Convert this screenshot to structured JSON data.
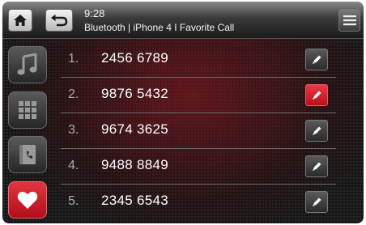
{
  "header": {
    "time": "9:28",
    "breadcrumb": "Bluetooth | iPhone 4 I Favorite Call"
  },
  "toolbar": {
    "home_icon": "home-icon",
    "back_icon": "back-arrow-icon",
    "menu_icon": "hamburger-menu-icon"
  },
  "sidebar": {
    "items": [
      {
        "icon": "music-note-icon",
        "active": false
      },
      {
        "icon": "keypad-grid-icon",
        "active": false
      },
      {
        "icon": "phonebook-icon",
        "active": false
      },
      {
        "icon": "heart-icon",
        "active": true
      }
    ]
  },
  "favorites": [
    {
      "index": "1.",
      "number": "2456 6789",
      "selected": false
    },
    {
      "index": "2.",
      "number": "9876 5432",
      "selected": true
    },
    {
      "index": "3.",
      "number": "9674 3625",
      "selected": false
    },
    {
      "index": "4.",
      "number": "9488 8849",
      "selected": false
    },
    {
      "index": "5.",
      "number": "2345 6543",
      "selected": false
    }
  ],
  "colors": {
    "accent_red": "#c8141f",
    "background_red_glow": "#7d161e",
    "text_white": "#ffffff"
  }
}
